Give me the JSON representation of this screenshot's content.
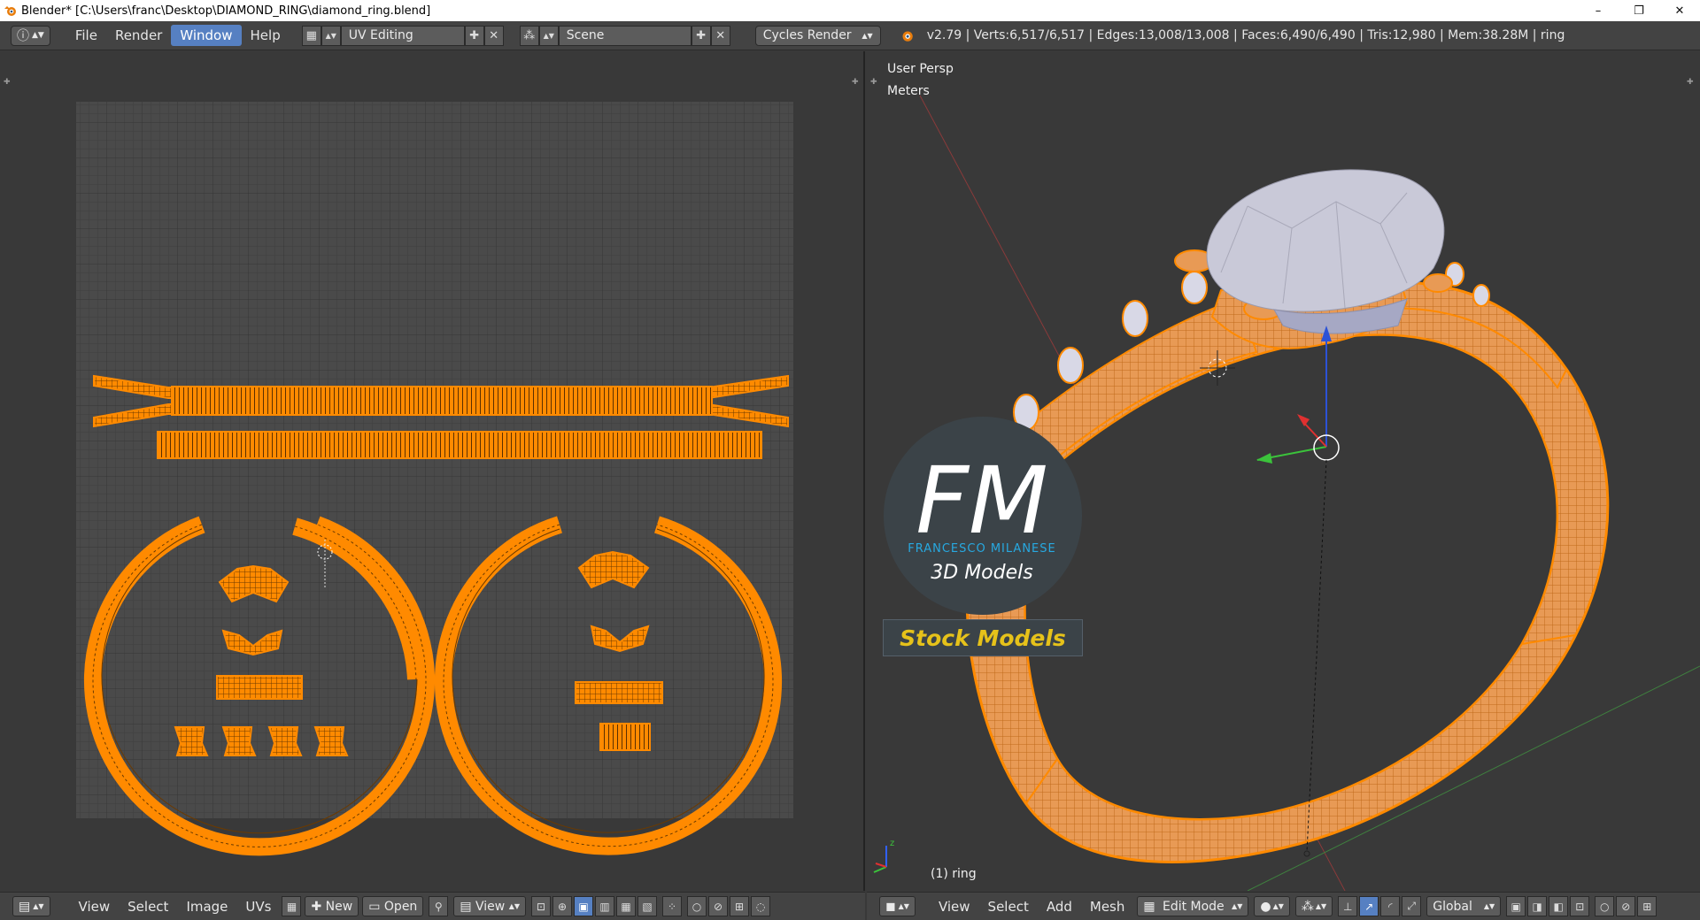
{
  "window": {
    "title": "Blender* [C:\\Users\\franc\\Desktop\\DIAMOND_RING\\diamond_ring.blend]",
    "controls": [
      "–",
      "❐",
      "✕"
    ]
  },
  "topbar": {
    "menus": [
      "File",
      "Render",
      "Window",
      "Help"
    ],
    "active_menu": "Window",
    "layout": "UV Editing",
    "scene": "Scene",
    "engine": "Cycles Render",
    "stats": "v2.79 | Verts:6,517/6,517 | Edges:13,008/13,008 | Faces:6,490/6,490 | Tris:12,980 | Mem:38.28M | ring"
  },
  "viewport": {
    "view_name": "User Persp",
    "units": "Meters",
    "object_label": "(1) ring"
  },
  "uv_bottom": {
    "menus": [
      "View",
      "Select",
      "Image",
      "UVs"
    ],
    "new_label": "New",
    "open_label": "Open",
    "view_label": "View"
  },
  "vp_bottom": {
    "menus": [
      "View",
      "Select",
      "Add",
      "Mesh"
    ],
    "mode": "Edit Mode",
    "orientation": "Global"
  },
  "watermark": {
    "logo_letters": "FM",
    "brand": "FRANCESCO MILANESE",
    "sub": "3D Models",
    "badge": "Stock Models"
  },
  "colors": {
    "uv_orange": "#ff8a00",
    "header": "#434343",
    "bg": "#393939",
    "accent_blue": "#5680c2"
  }
}
